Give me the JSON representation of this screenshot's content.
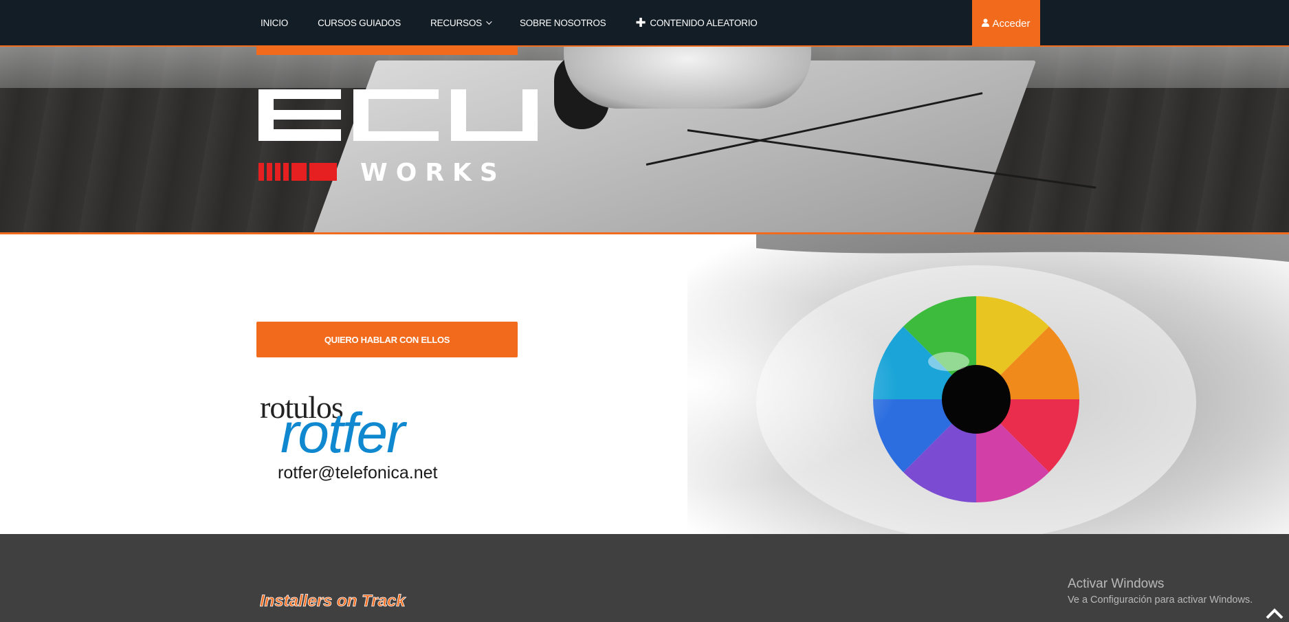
{
  "nav": {
    "items": [
      {
        "label": "INICIO"
      },
      {
        "label": "CURSOS GUIADOS"
      },
      {
        "label": "RECURSOS"
      },
      {
        "label": "SOBRE NOSOTROS"
      },
      {
        "label": "CONTENIDO ALEATORIO"
      }
    ],
    "login_label": "Acceder",
    "random_icon": "plus-icon",
    "resources_icon": "chevron-down-icon",
    "login_icon": "user-icon"
  },
  "hero": {
    "logo_text": "ECU",
    "logo_subtext": "WORKS"
  },
  "sponsor": {
    "cta_label": "QUIERO HABLAR CON ELLOS",
    "logo_small": "rotulos",
    "logo_big": "rotfer",
    "email": "rotfer@telefonica.net"
  },
  "footer": {
    "logo_text": "Installers on Track",
    "windows_title": "Activar Windows",
    "windows_sub": "Ve a Configuración para activar Windows.",
    "scroll_icon": "chevron-up-icon"
  },
  "colors": {
    "navbar_bg": "#121d26",
    "accent": "#f26b1d",
    "footer_bg": "#404040",
    "rotfer_blue": "#0f88cf"
  }
}
